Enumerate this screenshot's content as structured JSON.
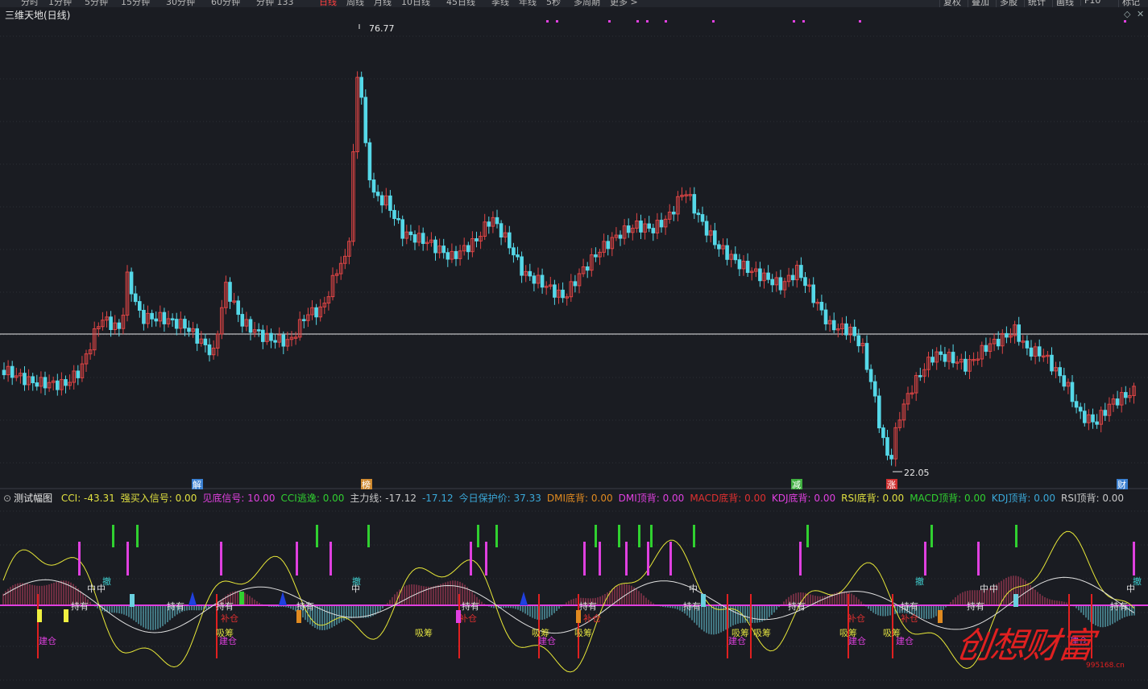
{
  "toolbar": {
    "timeframes": [
      "分时",
      "1分钟",
      "5分钟",
      "15分钟",
      "30分钟",
      "60分钟",
      "分钟 133",
      "日线",
      "周线",
      "月线",
      "10日线",
      "45日线",
      "季线",
      "年线",
      "5秒",
      "多周期",
      "更多 >"
    ],
    "active_timeframe": "日线",
    "buttons": [
      "复权",
      "叠加",
      "多股",
      "统计",
      "画线",
      "F10",
      "标记"
    ]
  },
  "main_chart": {
    "title": "三维天地(日线)",
    "high_label": "76.77",
    "low_label": "22.05",
    "event_markers": [
      "解",
      "榜",
      "减",
      "涨",
      "财"
    ]
  },
  "indicator": {
    "name": "测试幅图",
    "values": [
      {
        "text": "CCI: -43.31",
        "color": "#e0e040"
      },
      {
        "text": "强买入信号: 0.00",
        "color": "#e0e040"
      },
      {
        "text": "见底信号: 10.00",
        "color": "#e040e0"
      },
      {
        "text": "CCI逃逸: 0.00",
        "color": "#30d030"
      },
      {
        "text": "主力线: -17.12",
        "color": "#c8c8c8"
      },
      {
        "text": "-17.12",
        "color": "#3aa8d8"
      },
      {
        "text": "今日保护价: 37.33",
        "color": "#3aa8d8"
      },
      {
        "text": "DMI底背: 0.00",
        "color": "#e08a20"
      },
      {
        "text": "DMI顶背: 0.00",
        "color": "#e040e0"
      },
      {
        "text": "MACD底背: 0.00",
        "color": "#e03030"
      },
      {
        "text": "KDJ底背: 0.00",
        "color": "#e040e0"
      },
      {
        "text": "RSI底背: 0.00",
        "color": "#e0e040"
      },
      {
        "text": "MACD顶背: 0.00",
        "color": "#30d030"
      },
      {
        "text": "KDJ顶背: 0.00",
        "color": "#3aa8d8"
      },
      {
        "text": "RSI顶背: 0.00",
        "color": "#c8c8c8"
      }
    ],
    "signal_labels": {
      "hold": "持有",
      "build": "建仓",
      "absorb": "吸筹",
      "add": "补仓",
      "mid": "中",
      "retreat": "撤"
    }
  },
  "watermark": {
    "text": "创想财富",
    "url": "995168.cn"
  },
  "colors": {
    "background": "#1a1c22",
    "up_candle": "#e04545",
    "down_candle": "#55d8e8",
    "magenta": "#e040e0",
    "green": "#30d030",
    "yellow": "#f0f040"
  }
}
